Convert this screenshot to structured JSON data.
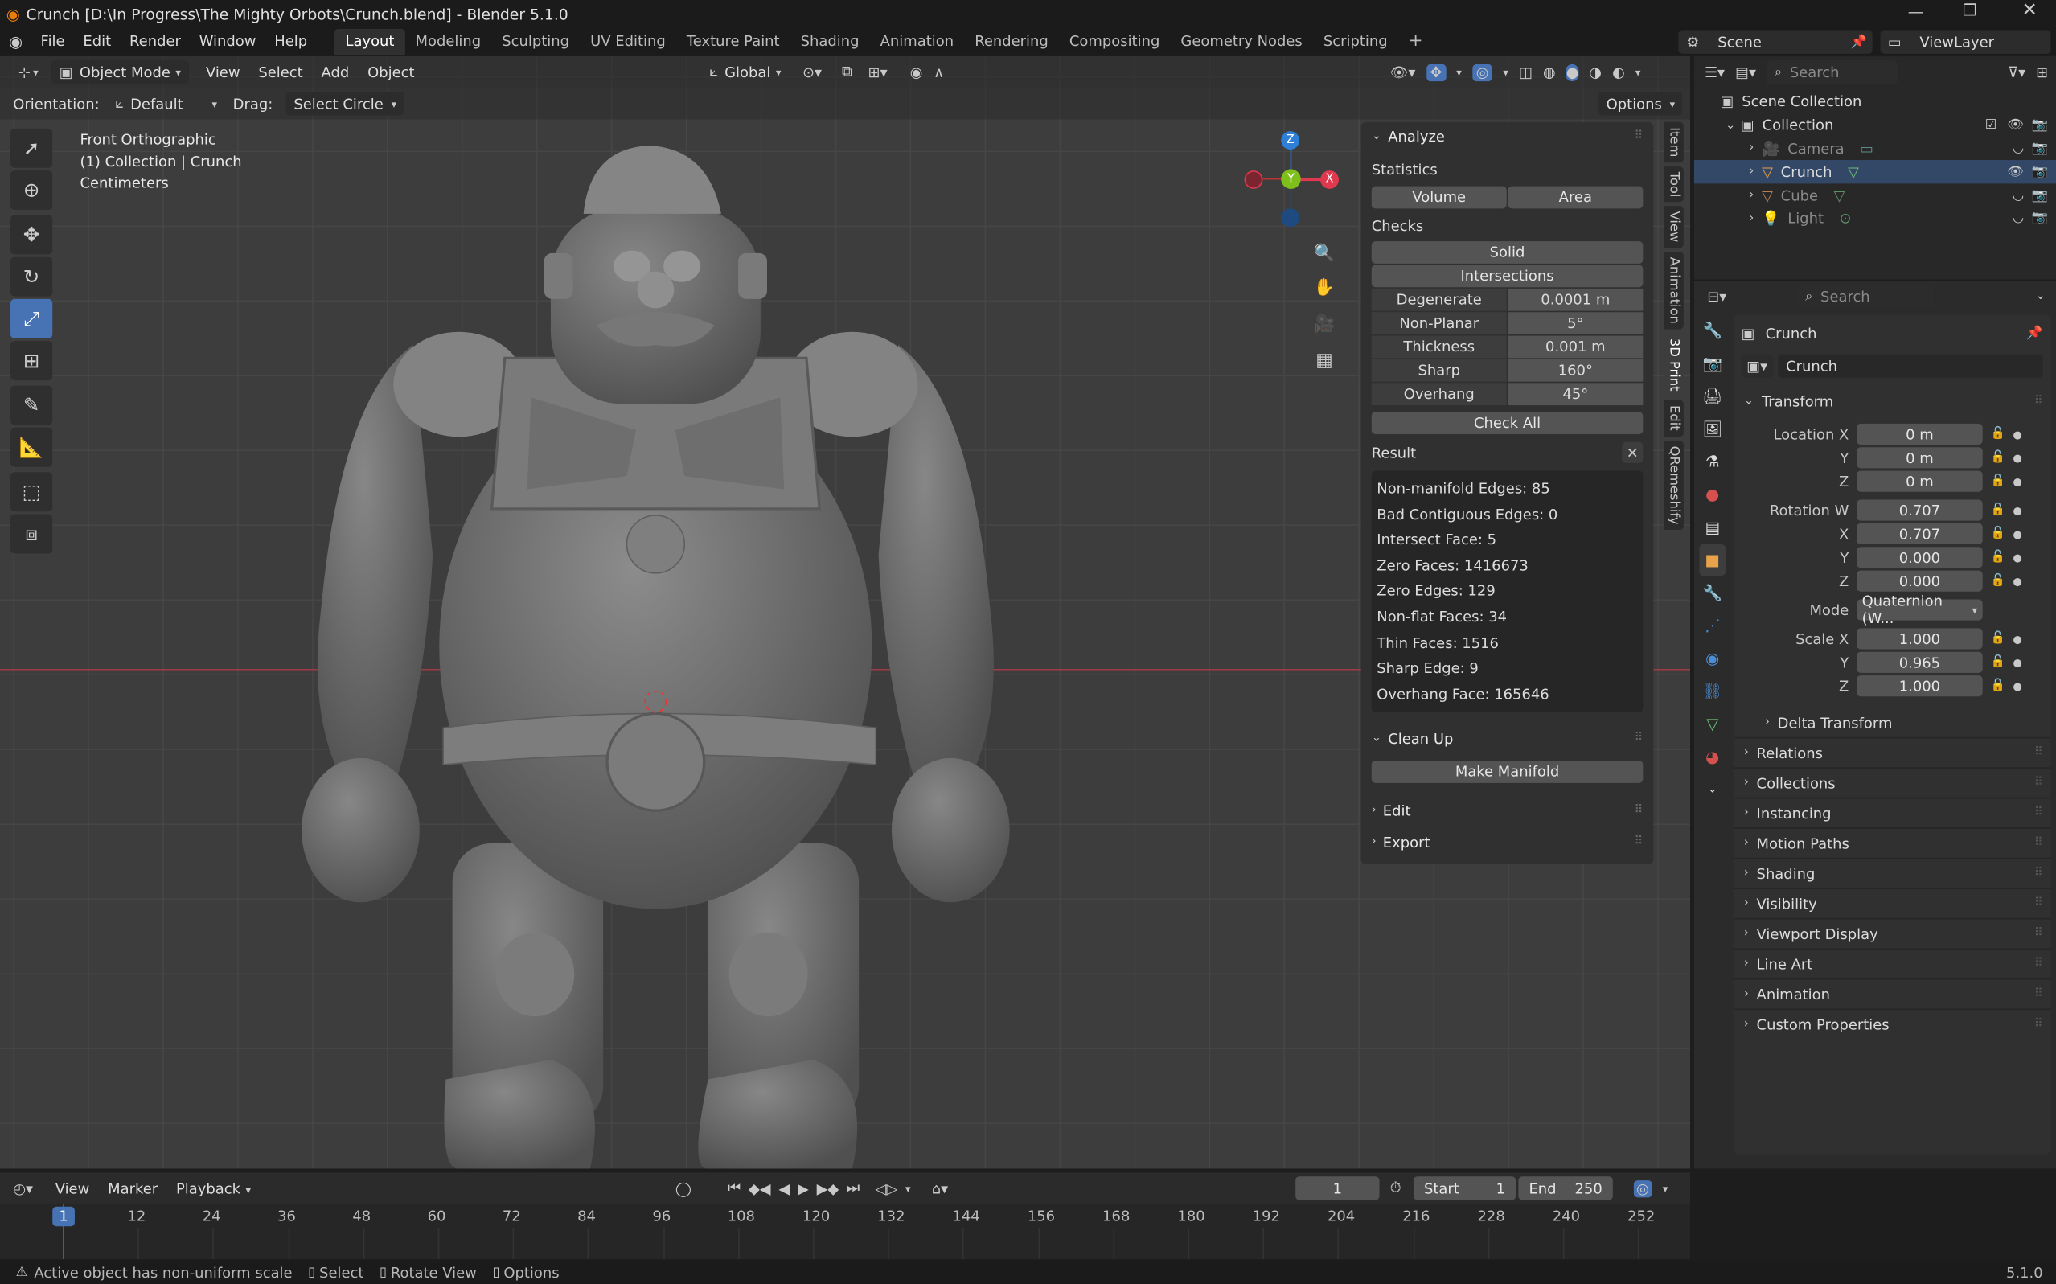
{
  "title": "Crunch [D:\\In Progress\\The Mighty Orbots\\Crunch.blend] - Blender 5.1.0",
  "menu": [
    "File",
    "Edit",
    "Render",
    "Window",
    "Help"
  ],
  "workspaces": [
    "Layout",
    "Modeling",
    "Sculpting",
    "UV Editing",
    "Texture Paint",
    "Shading",
    "Animation",
    "Rendering",
    "Compositing",
    "Geometry Nodes",
    "Scripting"
  ],
  "active_workspace": "Layout",
  "scene": {
    "label": "Scene"
  },
  "view_layer": {
    "label": "ViewLayer"
  },
  "viewport": {
    "mode": "Object Mode",
    "header_menus": [
      "View",
      "Select",
      "Add",
      "Object"
    ],
    "transform_orientation": "Global",
    "orientation_label": "Orientation:",
    "orientation_value": "Default",
    "drag_label": "Drag:",
    "drag_value": "Select Circle",
    "options_label": "Options",
    "overlay_text": [
      "Front Orthographic",
      "(1) Collection | Crunch",
      "Centimeters"
    ],
    "gizmo_axes": {
      "z": "Z",
      "y": "Y",
      "x": "X"
    }
  },
  "npanel": {
    "analyze_title": "Analyze",
    "statistics_label": "Statistics",
    "stats_buttons": [
      "Volume",
      "Area"
    ],
    "checks_label": "Checks",
    "checks_buttons": [
      "Solid",
      "Intersections"
    ],
    "check_params": [
      {
        "label": "Degenerate",
        "value": "0.0001 m"
      },
      {
        "label": "Non-Planar",
        "value": "5°"
      },
      {
        "label": "Thickness",
        "value": "0.001 m"
      },
      {
        "label": "Sharp",
        "value": "160°"
      },
      {
        "label": "Overhang",
        "value": "45°"
      }
    ],
    "check_all": "Check All",
    "result_label": "Result",
    "results": [
      "Non-manifold Edges: 85",
      "Bad Contiguous Edges: 0",
      "Intersect Face: 5",
      "Zero Faces: 1416673",
      "Zero Edges: 129",
      "Non-flat Faces: 34",
      "Thin Faces: 1516",
      "Sharp Edge: 9",
      "Overhang Face: 165646"
    ],
    "cleanup_title": "Clean Up",
    "make_manifold": "Make Manifold",
    "edit_title": "Edit",
    "export_title": "Export"
  },
  "side_tabs": [
    "Item",
    "Tool",
    "View",
    "Animation",
    "3D Print",
    "Edit",
    "QRemeshify"
  ],
  "active_side_tab": "3D Print",
  "outliner": {
    "search_placeholder": "Search",
    "scene_collection": "Scene Collection",
    "collection": "Collection",
    "items": [
      "Camera",
      "Crunch",
      "Cube",
      "Light"
    ]
  },
  "properties": {
    "search_placeholder": "Search",
    "object_name": "Crunch",
    "object_field": "Crunch",
    "transform_title": "Transform",
    "location_label": "Location X",
    "location": {
      "x": "0 m",
      "y": "0 m",
      "z": "0 m"
    },
    "rotation_label": "Rotation W",
    "rotation": {
      "w": "0.707",
      "x": "0.707",
      "y": "0.000",
      "z": "0.000"
    },
    "mode_label": "Mode",
    "mode_value": "Quaternion (W...",
    "scale_label": "Scale X",
    "scale": {
      "x": "1.000",
      "y": "0.965",
      "z": "1.000"
    },
    "axis_labels": {
      "x": "X",
      "y": "Y",
      "z": "Z"
    },
    "delta_transform": "Delta Transform",
    "sections": [
      "Relations",
      "Collections",
      "Instancing",
      "Motion Paths",
      "Shading",
      "Visibility",
      "Viewport Display",
      "Line Art",
      "Animation",
      "Custom Properties"
    ]
  },
  "timeline": {
    "menus": [
      "View",
      "Marker",
      "Playback"
    ],
    "current_frame": "1",
    "start_label": "Start",
    "start": "1",
    "end_label": "End",
    "end": "250",
    "ruler": [
      "1",
      "12",
      "24",
      "36",
      "48",
      "60",
      "72",
      "84",
      "96",
      "108",
      "120",
      "132",
      "144",
      "156",
      "168",
      "180",
      "192",
      "204",
      "216",
      "228",
      "240",
      "252"
    ]
  },
  "status": {
    "warning": "Active object has non-uniform scale",
    "hints": [
      "Select",
      "Rotate View",
      "Options"
    ],
    "version": "5.1.0"
  },
  "colors": {
    "accent": "#4772b3",
    "x_axis": "#e0384f",
    "y_axis": "#7fbf1a",
    "z_axis": "#2d7fd8",
    "panel": "#303030",
    "field": "#545454"
  }
}
